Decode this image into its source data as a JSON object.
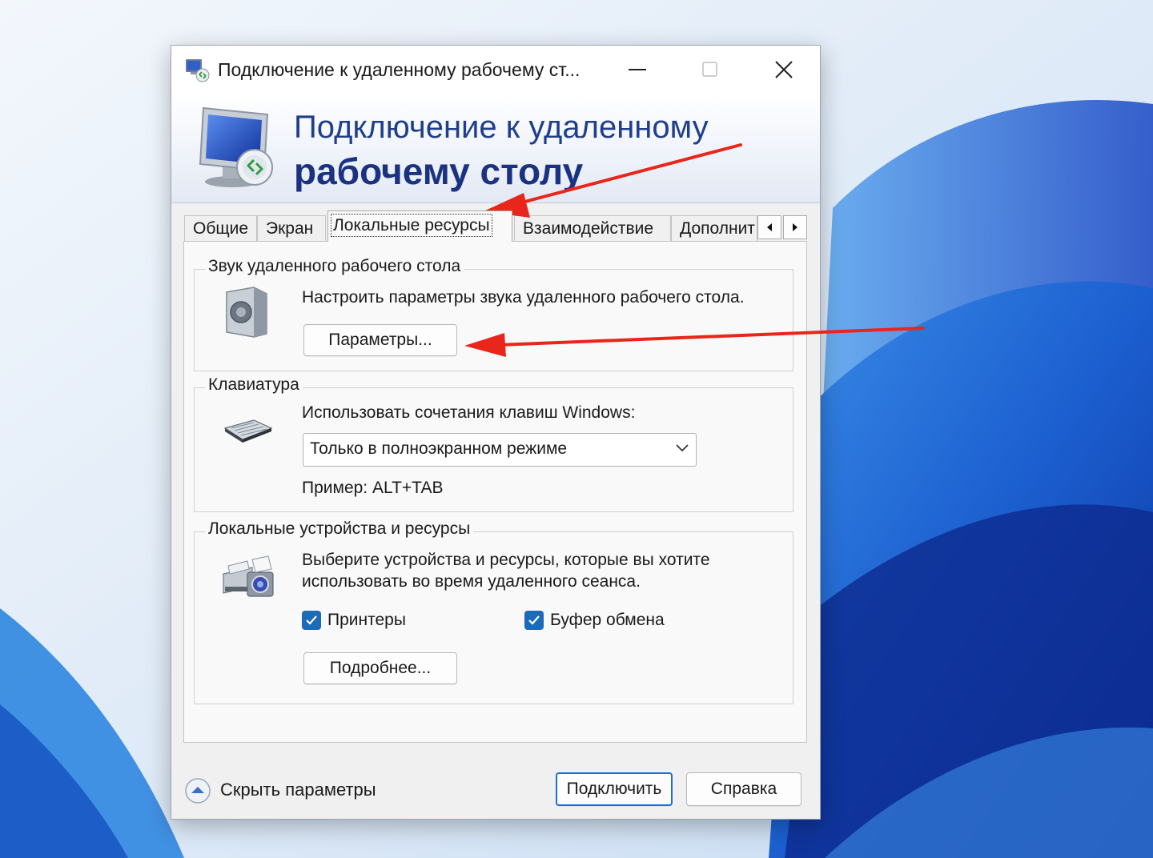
{
  "window": {
    "title": "Подключение к удаленному рабочему ст...",
    "minimize_glyph": "—",
    "close_glyph": "✕"
  },
  "banner": {
    "line1": "Подключение к удаленному",
    "line2": "рабочему столу"
  },
  "tabs": [
    {
      "label": "Общие",
      "active": false
    },
    {
      "label": "Экран",
      "active": false
    },
    {
      "label": "Локальные ресурсы",
      "active": true
    },
    {
      "label": "Взаимодействие",
      "active": false
    },
    {
      "label": "Дополнит",
      "active": false
    }
  ],
  "sound": {
    "title": "Звук удаленного рабочего стола",
    "description": "Настроить параметры звука удаленного рабочего стола.",
    "button": "Параметры..."
  },
  "keyboard": {
    "title": "Клавиатура",
    "description": "Использовать сочетания клавиш Windows:",
    "selected": "Только в полноэкранном режиме",
    "example": "Пример: ALT+TAB"
  },
  "devices": {
    "title": "Локальные устройства и ресурсы",
    "description_line1": "Выберите устройства и ресурсы, которые вы хотите",
    "description_line2": "использовать во время удаленного сеанса.",
    "printers": {
      "label": "Принтеры",
      "checked": true
    },
    "clipboard": {
      "label": "Буфер обмена",
      "checked": true
    },
    "button": "Подробнее..."
  },
  "footer": {
    "toggle_label": "Скрыть параметры",
    "connect": "Подключить",
    "help": "Справка"
  },
  "colors": {
    "banner_text": "#1f3f8c",
    "checkbox": "#1c6bb8",
    "annotation_arrow": "#e8261b",
    "primary_border": "#1f6fd0"
  }
}
